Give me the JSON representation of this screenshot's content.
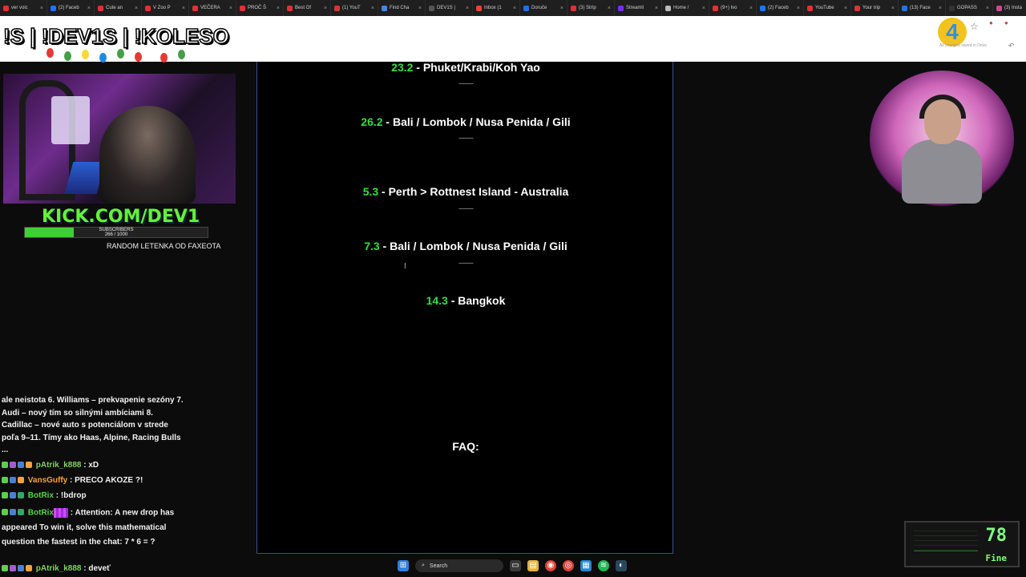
{
  "browser": {
    "tabs": [
      {
        "label": "ver voic",
        "color": "#d33"
      },
      {
        "label": "(2) Faceb",
        "color": "#1877f2"
      },
      {
        "label": "Cute an",
        "color": "#d33"
      },
      {
        "label": "V Zoo P",
        "color": "#d33"
      },
      {
        "label": "VEČERA",
        "color": "#d33"
      },
      {
        "label": "PROČ Š",
        "color": "#d33"
      },
      {
        "label": "Best Of",
        "color": "#d33"
      },
      {
        "label": "(1) YouT",
        "color": "#d33"
      },
      {
        "label": "Find Cha",
        "color": "#4285f4"
      },
      {
        "label": "DEV1S |",
        "color": "#555"
      },
      {
        "label": "Inbox (1",
        "color": "#ea4335"
      },
      {
        "label": "Doruče",
        "color": "#1a73e8"
      },
      {
        "label": "(3) Stríp",
        "color": "#d33"
      },
      {
        "label": "Streamli",
        "color": "#7b2cf0"
      },
      {
        "label": "Home /",
        "color": "#bbb"
      },
      {
        "label": "(9+) Ivo",
        "color": "#d33"
      },
      {
        "label": "(2) Faceb",
        "color": "#1877f2"
      },
      {
        "label": "YouTube",
        "color": "#d33"
      },
      {
        "label": "Your trip",
        "color": "#d33"
      },
      {
        "label": "(13) Face",
        "color": "#1877f2"
      },
      {
        "label": "GOPASS",
        "color": "#333"
      },
      {
        "label": "(3) Insta",
        "color": "#d4468b"
      }
    ]
  },
  "overlay": {
    "title": "!S | !DEV1S | !KOLESO",
    "kick_url": "KICK.COM/DEV1",
    "subscribers_label": "SUBSCRIBERS",
    "subscribers_count": "266 / 1000",
    "subscribers_progress": 0.266,
    "random_label": "RANDOM LETENKA OD FAXEOTA"
  },
  "header": {
    "badge": "4",
    "saved_text": "All changes saved in Drive"
  },
  "document": {
    "entries": [
      {
        "date": "23.2",
        "text": " - Phuket/Krabi/Koh Yao"
      },
      {
        "date": "26.2",
        "text": "  - Bali / Lombok / Nusa Penida / Gili"
      },
      {
        "date": "5.3",
        "text": " - Perth > Rottnest Island - Australia"
      },
      {
        "date": "7.3",
        "text": " - Bali / Lombok / Nusa Penida / Gili"
      },
      {
        "date": "14.3",
        "text": " - Bangkok"
      }
    ],
    "separator": "---------",
    "faq": "FAQ:"
  },
  "chat": {
    "announcement": "ale neistota 6. Williams – prekvapenie sezóny 7. Audi – nový tím so silnými ambíciami 8. Cadillac – nové auto s potenciálom v strede poľa 9–11. Tímy ako Haas, Alpine, Racing Bulls ...",
    "messages": [
      {
        "user": "pAtrik_k888",
        "color": "#7fd35b",
        "text": " : xD"
      },
      {
        "user": "VansGuffy",
        "color": "#f2a33a",
        "text": " : PRECO AKOZE ?!"
      },
      {
        "user": "BotRix",
        "color": "#5ad14a",
        "text": " : !bdrop"
      },
      {
        "user": "BotRix",
        "color": "#5ad14a",
        "text": " : Attention: A new drop has appeared  To win it, solve this mathematical question the fastest in the chat: 7 * 6 = ?"
      },
      {
        "user": "pAtrik_k888",
        "color": "#7fd35b",
        "text": " : deveť"
      }
    ]
  },
  "gauge": {
    "value": "78",
    "label": "Fine"
  },
  "taskbar": {
    "search_label": "Search"
  }
}
